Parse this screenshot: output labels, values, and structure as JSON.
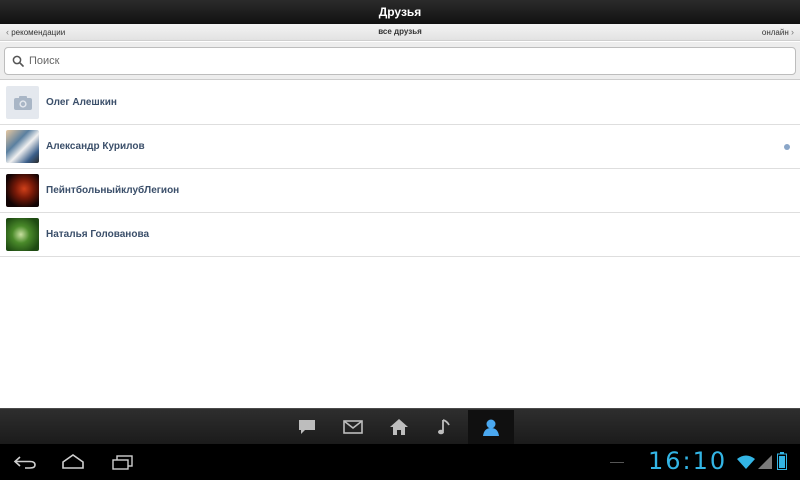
{
  "header": {
    "title": "Друзья"
  },
  "subtabs": {
    "left": "рекомендации",
    "center": "все друзья",
    "right": "онлайн"
  },
  "search": {
    "placeholder": "Поиск",
    "value": ""
  },
  "friends": [
    {
      "name": "Олег Алешкин",
      "online": false,
      "avatar": "camera-placeholder-icon"
    },
    {
      "name": "Александр Курилов",
      "online": true,
      "avatar": "photo"
    },
    {
      "name": "ПейнтбольныйклубЛегион",
      "online": false,
      "avatar": "photo"
    },
    {
      "name": "Наталья Голованова",
      "online": false,
      "avatar": "photo"
    }
  ],
  "app_nav": {
    "items": [
      "messages-icon",
      "mail-icon",
      "home-icon",
      "music-icon",
      "friends-icon"
    ],
    "active": "friends-icon"
  },
  "system_bar": {
    "time": "16:10",
    "buttons": [
      "back-icon",
      "home-icon",
      "recent-apps-icon"
    ],
    "status_icons": [
      "wifi-icon",
      "signal-icon",
      "battery-icon"
    ]
  },
  "colors": {
    "accent": "#33b5e5",
    "friend_name": "#3b4f6a",
    "online_dot": "#8aa6c8",
    "active_nav_icon": "#4aa8f0"
  }
}
